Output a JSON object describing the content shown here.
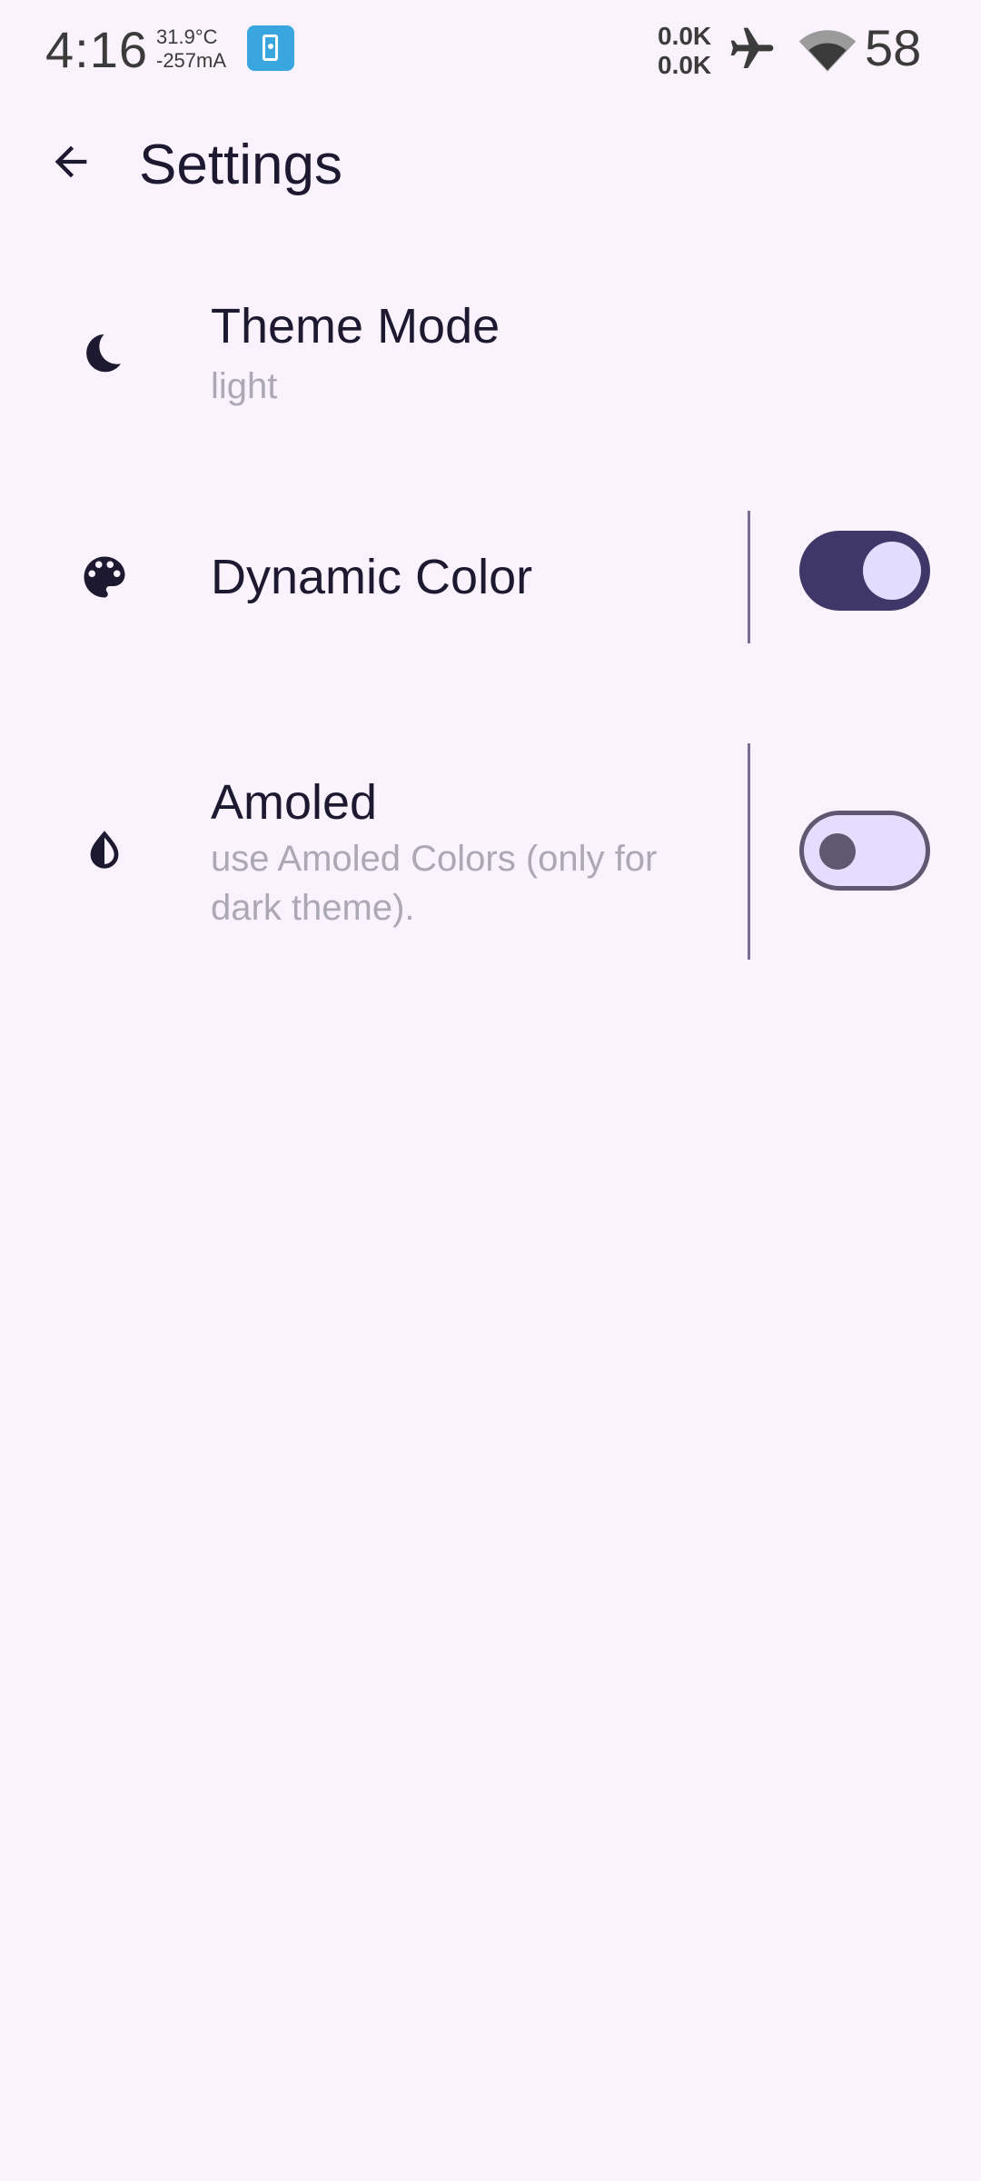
{
  "status_bar": {
    "time": "4:16",
    "temperature": "31.9°C",
    "current": "-257mA",
    "net_up": "0.0K",
    "net_down": "0.0K",
    "battery": "58",
    "icons": [
      "app-phone-icon",
      "airplane-icon",
      "wifi-icon"
    ]
  },
  "app_bar": {
    "title": "Settings",
    "back_icon": "arrow-back-icon"
  },
  "settings": [
    {
      "icon": "moon-icon",
      "title": "Theme Mode",
      "subtitle": "light"
    },
    {
      "icon": "palette-icon",
      "title": "Dynamic Color",
      "toggle": true
    },
    {
      "icon": "contrast-drop-icon",
      "title": "Amoled",
      "subtitle": "use Amoled Colors (only for dark theme).",
      "toggle": false
    }
  ],
  "colors": {
    "background": "#faf3fd",
    "primary": "#3e3768",
    "on_surface": "#1d1930",
    "subtitle": "#aca8b4"
  }
}
